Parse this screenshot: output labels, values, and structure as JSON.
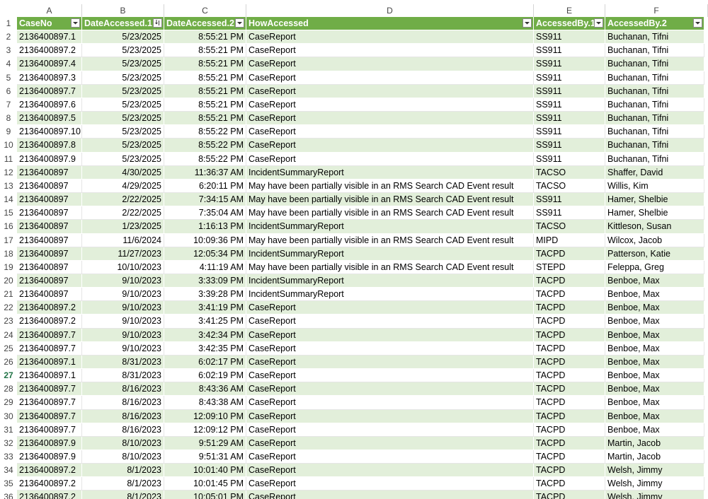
{
  "columns": [
    "A",
    "B",
    "C",
    "D",
    "E",
    "F"
  ],
  "header_row_number": "1",
  "headers": [
    "CaseNo",
    "DateAccessed.1",
    "DateAccessed.2",
    "HowAccessed",
    "AccessedBy.1",
    "AccessedBy.2"
  ],
  "rows": [
    {
      "n": "2",
      "a": "2136400897.1",
      "b": "5/23/2025",
      "c": "8:55:21 PM",
      "d": "CaseReport",
      "e": "SS911",
      "f": "Buchanan, Tifni"
    },
    {
      "n": "3",
      "a": "2136400897.2",
      "b": "5/23/2025",
      "c": "8:55:21 PM",
      "d": "CaseReport",
      "e": "SS911",
      "f": "Buchanan, Tifni"
    },
    {
      "n": "4",
      "a": "2136400897.4",
      "b": "5/23/2025",
      "c": "8:55:21 PM",
      "d": "CaseReport",
      "e": "SS911",
      "f": "Buchanan, Tifni"
    },
    {
      "n": "5",
      "a": "2136400897.3",
      "b": "5/23/2025",
      "c": "8:55:21 PM",
      "d": "CaseReport",
      "e": "SS911",
      "f": "Buchanan, Tifni"
    },
    {
      "n": "6",
      "a": "2136400897.7",
      "b": "5/23/2025",
      "c": "8:55:21 PM",
      "d": "CaseReport",
      "e": "SS911",
      "f": "Buchanan, Tifni"
    },
    {
      "n": "7",
      "a": "2136400897.6",
      "b": "5/23/2025",
      "c": "8:55:21 PM",
      "d": "CaseReport",
      "e": "SS911",
      "f": "Buchanan, Tifni"
    },
    {
      "n": "8",
      "a": "2136400897.5",
      "b": "5/23/2025",
      "c": "8:55:21 PM",
      "d": "CaseReport",
      "e": "SS911",
      "f": "Buchanan, Tifni"
    },
    {
      "n": "9",
      "a": "2136400897.10",
      "b": "5/23/2025",
      "c": "8:55:22 PM",
      "d": "CaseReport",
      "e": "SS911",
      "f": "Buchanan, Tifni"
    },
    {
      "n": "10",
      "a": "2136400897.8",
      "b": "5/23/2025",
      "c": "8:55:22 PM",
      "d": "CaseReport",
      "e": "SS911",
      "f": "Buchanan, Tifni"
    },
    {
      "n": "11",
      "a": "2136400897.9",
      "b": "5/23/2025",
      "c": "8:55:22 PM",
      "d": "CaseReport",
      "e": "SS911",
      "f": "Buchanan, Tifni"
    },
    {
      "n": "12",
      "a": "2136400897",
      "b": "4/30/2025",
      "c": "11:36:37 AM",
      "d": "IncidentSummaryReport",
      "e": "TACSO",
      "f": "Shaffer, David"
    },
    {
      "n": "13",
      "a": "2136400897",
      "b": "4/29/2025",
      "c": "6:20:11 PM",
      "d": "May have been partially visible in an RMS Search CAD Event result",
      "e": "TACSO",
      "f": "Willis, Kim"
    },
    {
      "n": "14",
      "a": "2136400897",
      "b": "2/22/2025",
      "c": "7:34:15 AM",
      "d": "May have been partially visible in an RMS Search CAD Event result",
      "e": "SS911",
      "f": "Hamer, Shelbie"
    },
    {
      "n": "15",
      "a": "2136400897",
      "b": "2/22/2025",
      "c": "7:35:04 AM",
      "d": "May have been partially visible in an RMS Search CAD Event result",
      "e": "SS911",
      "f": "Hamer, Shelbie"
    },
    {
      "n": "16",
      "a": "2136400897",
      "b": "1/23/2025",
      "c": "1:16:13 PM",
      "d": "IncidentSummaryReport",
      "e": "TACSO",
      "f": "Kittleson, Susan"
    },
    {
      "n": "17",
      "a": "2136400897",
      "b": "11/6/2024",
      "c": "10:09:36 PM",
      "d": "May have been partially visible in an RMS Search CAD Event result",
      "e": "MIPD",
      "f": "Wilcox, Jacob"
    },
    {
      "n": "18",
      "a": "2136400897",
      "b": "11/27/2023",
      "c": "12:05:34 PM",
      "d": "IncidentSummaryReport",
      "e": "TACPD",
      "f": "Patterson, Katie"
    },
    {
      "n": "19",
      "a": "2136400897",
      "b": "10/10/2023",
      "c": "4:11:19 AM",
      "d": "May have been partially visible in an RMS Search CAD Event result",
      "e": "STEPD",
      "f": "Feleppa, Greg"
    },
    {
      "n": "20",
      "a": "2136400897",
      "b": "9/10/2023",
      "c": "3:33:09 PM",
      "d": "IncidentSummaryReport",
      "e": "TACPD",
      "f": "Benboe, Max"
    },
    {
      "n": "21",
      "a": "2136400897",
      "b": "9/10/2023",
      "c": "3:39:28 PM",
      "d": "IncidentSummaryReport",
      "e": "TACPD",
      "f": "Benboe, Max"
    },
    {
      "n": "22",
      "a": "2136400897.2",
      "b": "9/10/2023",
      "c": "3:41:19 PM",
      "d": "CaseReport",
      "e": "TACPD",
      "f": "Benboe, Max"
    },
    {
      "n": "23",
      "a": "2136400897.2",
      "b": "9/10/2023",
      "c": "3:41:25 PM",
      "d": "CaseReport",
      "e": "TACPD",
      "f": "Benboe, Max"
    },
    {
      "n": "24",
      "a": "2136400897.7",
      "b": "9/10/2023",
      "c": "3:42:34 PM",
      "d": "CaseReport",
      "e": "TACPD",
      "f": "Benboe, Max"
    },
    {
      "n": "25",
      "a": "2136400897.7",
      "b": "9/10/2023",
      "c": "3:42:35 PM",
      "d": "CaseReport",
      "e": "TACPD",
      "f": "Benboe, Max"
    },
    {
      "n": "26",
      "a": "2136400897.1",
      "b": "8/31/2023",
      "c": "6:02:17 PM",
      "d": "CaseReport",
      "e": "TACPD",
      "f": "Benboe, Max"
    },
    {
      "n": "27",
      "a": "2136400897.1",
      "b": "8/31/2023",
      "c": "6:02:19 PM",
      "d": "CaseReport",
      "e": "TACPD",
      "f": "Benboe, Max"
    },
    {
      "n": "28",
      "a": "2136400897.7",
      "b": "8/16/2023",
      "c": "8:43:36 AM",
      "d": "CaseReport",
      "e": "TACPD",
      "f": "Benboe, Max"
    },
    {
      "n": "29",
      "a": "2136400897.7",
      "b": "8/16/2023",
      "c": "8:43:38 AM",
      "d": "CaseReport",
      "e": "TACPD",
      "f": "Benboe, Max"
    },
    {
      "n": "30",
      "a": "2136400897.7",
      "b": "8/16/2023",
      "c": "12:09:10 PM",
      "d": "CaseReport",
      "e": "TACPD",
      "f": "Benboe, Max"
    },
    {
      "n": "31",
      "a": "2136400897.7",
      "b": "8/16/2023",
      "c": "12:09:12 PM",
      "d": "CaseReport",
      "e": "TACPD",
      "f": "Benboe, Max"
    },
    {
      "n": "32",
      "a": "2136400897.9",
      "b": "8/10/2023",
      "c": "9:51:29 AM",
      "d": "CaseReport",
      "e": "TACPD",
      "f": "Martin, Jacob"
    },
    {
      "n": "33",
      "a": "2136400897.9",
      "b": "8/10/2023",
      "c": "9:51:31 AM",
      "d": "CaseReport",
      "e": "TACPD",
      "f": "Martin, Jacob"
    },
    {
      "n": "34",
      "a": "2136400897.2",
      "b": "8/1/2023",
      "c": "10:01:40 PM",
      "d": "CaseReport",
      "e": "TACPD",
      "f": "Welsh, Jimmy"
    },
    {
      "n": "35",
      "a": "2136400897.2",
      "b": "8/1/2023",
      "c": "10:01:45 PM",
      "d": "CaseReport",
      "e": "TACPD",
      "f": "Welsh, Jimmy"
    },
    {
      "n": "36",
      "a": "2136400897.2",
      "b": "8/1/2023",
      "c": "10:05:01 PM",
      "d": "CaseReport",
      "e": "TACPD",
      "f": "Welsh, Jimmy"
    }
  ],
  "active_row": "27",
  "sorted_column": "DateAccessed.1",
  "colors": {
    "header_green": "#70ad47",
    "band_green": "#e2efda",
    "active_accent": "#217346"
  }
}
